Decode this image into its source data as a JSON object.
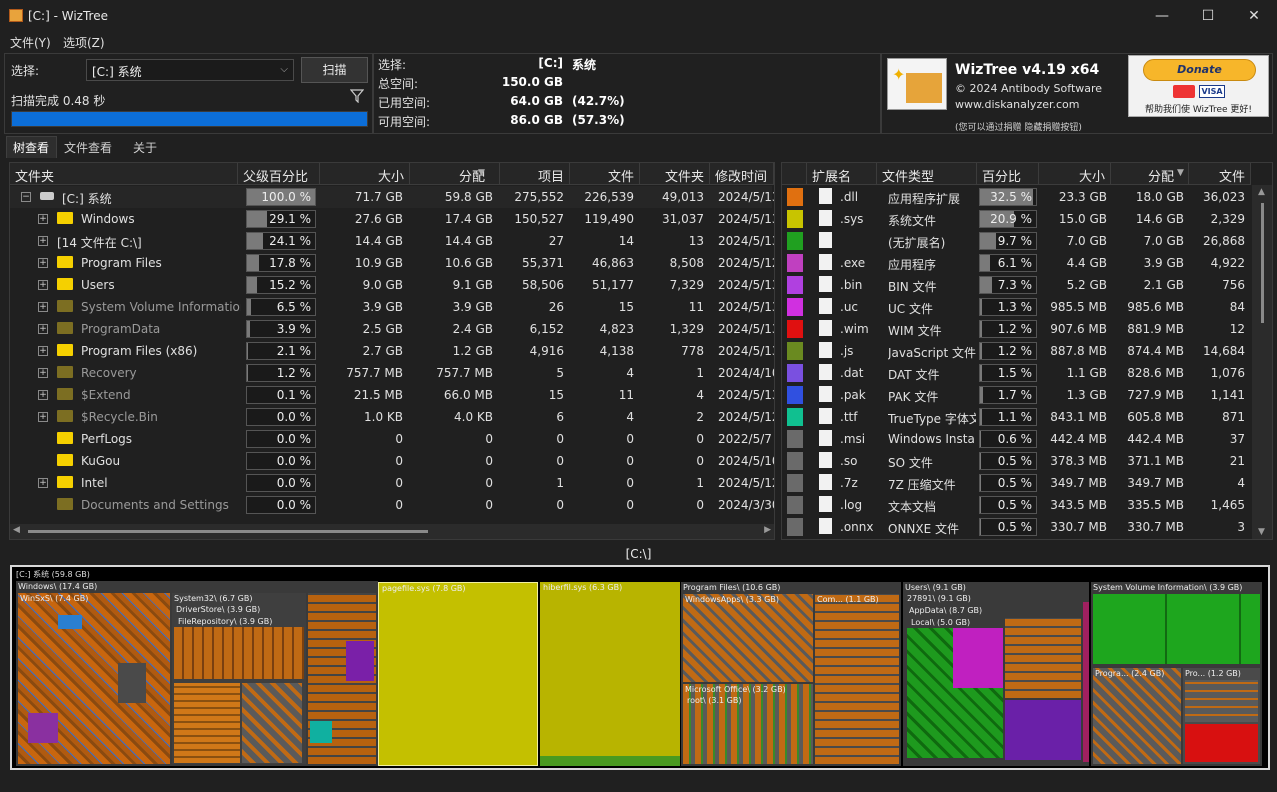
{
  "window": {
    "title": "[C:]  - WizTree",
    "minimize": "—",
    "maximize": "☐",
    "close": "✕"
  },
  "menu": {
    "file": "文件(Y)",
    "options": "选项(Z)"
  },
  "select_panel": {
    "select_label": "选择:",
    "drive_value": "[C:] 系统",
    "scan_button": "扫描",
    "status": "扫描完成 0.48 秒"
  },
  "drive_info": {
    "select_label": "选择:",
    "select_value": "[C:]",
    "select_name": "系统",
    "total_label": "总空间:",
    "total_value": "150.0 GB",
    "used_label": "已用空间:",
    "used_value": "64.0 GB",
    "used_pct": "(42.7%)",
    "free_label": "可用空间:",
    "free_value": "86.0 GB",
    "free_pct": "(57.3%)"
  },
  "about": {
    "app_name": "WizTree v4.19 x64",
    "copyright": "© 2024 Antibody Software",
    "website": "www.diskanalyzer.com",
    "hint": "(您可以通过捐赠 隐藏捐赠按钮)",
    "donate": "Donate",
    "donate_caption": "帮助我们使 WizTree 更好!"
  },
  "tabs": [
    "树查看",
    "文件查看",
    "关于"
  ],
  "tree_headers": [
    "文件夹",
    "父级百分比",
    "大小",
    "分配",
    "项目",
    "文件",
    "文件夹",
    "修改时间"
  ],
  "tree_rows": [
    {
      "name": "[C:] 系统",
      "pct": "100.0 %",
      "pct_value": 1.0,
      "size": "71.7 GB",
      "alloc": "59.8 GB",
      "items": "275,552",
      "files": "226,539",
      "folders": "49,013",
      "modified": "2024/5/13 1",
      "type": "drive"
    },
    {
      "name": "Windows",
      "pct": "29.1 %",
      "pct_value": 0.291,
      "size": "27.6 GB",
      "alloc": "17.4 GB",
      "items": "150,527",
      "files": "119,490",
      "folders": "31,037",
      "modified": "2024/5/13 1",
      "type": "folder"
    },
    {
      "name": "[14 文件在 C:\\]",
      "pct": "24.1 %",
      "pct_value": 0.241,
      "size": "14.4 GB",
      "alloc": "14.4 GB",
      "items": "27",
      "files": "14",
      "folders": "13",
      "modified": "2024/5/13 1",
      "type": "files"
    },
    {
      "name": "Program Files",
      "pct": "17.8 %",
      "pct_value": 0.178,
      "size": "10.9 GB",
      "alloc": "10.6 GB",
      "items": "55,371",
      "files": "46,863",
      "folders": "8,508",
      "modified": "2024/5/12 1",
      "type": "folder"
    },
    {
      "name": "Users",
      "pct": "15.2 %",
      "pct_value": 0.152,
      "size": "9.0 GB",
      "alloc": "9.1 GB",
      "items": "58,506",
      "files": "51,177",
      "folders": "7,329",
      "modified": "2024/5/13 1",
      "type": "folder"
    },
    {
      "name": "System Volume Information",
      "pct": "6.5 %",
      "pct_value": 0.065,
      "size": "3.9 GB",
      "alloc": "3.9 GB",
      "items": "26",
      "files": "15",
      "folders": "11",
      "modified": "2024/5/13 1",
      "type": "sysfolder"
    },
    {
      "name": "ProgramData",
      "pct": "3.9 %",
      "pct_value": 0.039,
      "size": "2.5 GB",
      "alloc": "2.4 GB",
      "items": "6,152",
      "files": "4,823",
      "folders": "1,329",
      "modified": "2024/5/13 1",
      "type": "sysfolder"
    },
    {
      "name": "Program Files (x86)",
      "pct": "2.1 %",
      "pct_value": 0.021,
      "size": "2.7 GB",
      "alloc": "1.2 GB",
      "items": "4,916",
      "files": "4,138",
      "folders": "778",
      "modified": "2024/5/13 1",
      "type": "folder"
    },
    {
      "name": "Recovery",
      "pct": "1.2 %",
      "pct_value": 0.012,
      "size": "757.7 MB",
      "alloc": "757.7 MB",
      "items": "5",
      "files": "4",
      "folders": "1",
      "modified": "2024/4/10 1",
      "type": "sysfolder"
    },
    {
      "name": "$Extend",
      "pct": "0.1 %",
      "pct_value": 0.001,
      "size": "21.5 MB",
      "alloc": "66.0 MB",
      "items": "15",
      "files": "11",
      "folders": "4",
      "modified": "2024/5/13 1",
      "type": "sysfolder"
    },
    {
      "name": "$Recycle.Bin",
      "pct": "0.0 %",
      "pct_value": 0.0,
      "size": "1.0 KB",
      "alloc": "4.0 KB",
      "items": "6",
      "files": "4",
      "folders": "2",
      "modified": "2024/5/12 1",
      "type": "sysfolder"
    },
    {
      "name": "PerfLogs",
      "pct": "0.0 %",
      "pct_value": 0.0,
      "size": "0",
      "alloc": "0",
      "items": "0",
      "files": "0",
      "folders": "0",
      "modified": "2022/5/7 13",
      "type": "folder"
    },
    {
      "name": "KuGou",
      "pct": "0.0 %",
      "pct_value": 0.0,
      "size": "0",
      "alloc": "0",
      "items": "0",
      "files": "0",
      "folders": "0",
      "modified": "2024/5/10 1",
      "type": "folder"
    },
    {
      "name": "Intel",
      "pct": "0.0 %",
      "pct_value": 0.0,
      "size": "0",
      "alloc": "0",
      "items": "1",
      "files": "0",
      "folders": "1",
      "modified": "2024/5/12 2",
      "type": "folder"
    },
    {
      "name": "Documents and Settings",
      "pct": "0.0 %",
      "pct_value": 0.0,
      "size": "0",
      "alloc": "0",
      "items": "0",
      "files": "0",
      "folders": "0",
      "modified": "2024/3/30 1",
      "type": "sysfolder"
    }
  ],
  "ext_headers": [
    "扩展名",
    "文件类型",
    "百分比",
    "大小",
    "分配",
    "文件"
  ],
  "ext_rows": [
    {
      "color": "#e07010",
      "ext": ".dll",
      "type": "应用程序扩展",
      "pct": "32.5 %",
      "pct_value": 0.325,
      "size": "23.3 GB",
      "alloc": "18.0 GB",
      "files": "36,023"
    },
    {
      "color": "#c8c400",
      "ext": ".sys",
      "type": "系统文件",
      "pct": "20.9 %",
      "pct_value": 0.209,
      "size": "15.0 GB",
      "alloc": "14.6 GB",
      "files": "2,329"
    },
    {
      "color": "#20a020",
      "ext": "",
      "type": "(无扩展名)",
      "pct": "9.7 %",
      "pct_value": 0.097,
      "size": "7.0 GB",
      "alloc": "7.0 GB",
      "files": "26,868"
    },
    {
      "color": "#c040c0",
      "ext": ".exe",
      "type": "应用程序",
      "pct": "6.1 %",
      "pct_value": 0.061,
      "size": "4.4 GB",
      "alloc": "3.9 GB",
      "files": "4,922"
    },
    {
      "color": "#b040e0",
      "ext": ".bin",
      "type": "BIN 文件",
      "pct": "7.3 %",
      "pct_value": 0.073,
      "size": "5.2 GB",
      "alloc": "2.1 GB",
      "files": "756"
    },
    {
      "color": "#d030e0",
      "ext": ".uc",
      "type": "UC 文件",
      "pct": "1.3 %",
      "pct_value": 0.013,
      "size": "985.5 MB",
      "alloc": "985.6 MB",
      "files": "84"
    },
    {
      "color": "#e01010",
      "ext": ".wim",
      "type": "WIM 文件",
      "pct": "1.2 %",
      "pct_value": 0.012,
      "size": "907.6 MB",
      "alloc": "881.9 MB",
      "files": "12"
    },
    {
      "color": "#6a8a20",
      "ext": ".js",
      "type": "JavaScript 文件",
      "pct": "1.2 %",
      "pct_value": 0.012,
      "size": "887.8 MB",
      "alloc": "874.4 MB",
      "files": "14,684"
    },
    {
      "color": "#7a50e0",
      "ext": ".dat",
      "type": "DAT 文件",
      "pct": "1.5 %",
      "pct_value": 0.015,
      "size": "1.1 GB",
      "alloc": "828.6 MB",
      "files": "1,076"
    },
    {
      "color": "#3050e0",
      "ext": ".pak",
      "type": "PAK 文件",
      "pct": "1.7 %",
      "pct_value": 0.017,
      "size": "1.3 GB",
      "alloc": "727.9 MB",
      "files": "1,141"
    },
    {
      "color": "#10c090",
      "ext": ".ttf",
      "type": "TrueType 字体文",
      "pct": "1.1 %",
      "pct_value": 0.011,
      "size": "843.1 MB",
      "alloc": "605.8 MB",
      "files": "871"
    },
    {
      "color": "#6a6a6a",
      "ext": ".msi",
      "type": "Windows Installe",
      "pct": "0.6 %",
      "pct_value": 0.006,
      "size": "442.4 MB",
      "alloc": "442.4 MB",
      "files": "37"
    },
    {
      "color": "#6a6a6a",
      "ext": ".so",
      "type": "SO 文件",
      "pct": "0.5 %",
      "pct_value": 0.005,
      "size": "378.3 MB",
      "alloc": "371.1 MB",
      "files": "21"
    },
    {
      "color": "#6a6a6a",
      "ext": ".7z",
      "type": "7Z 压缩文件",
      "pct": "0.5 %",
      "pct_value": 0.005,
      "size": "349.7 MB",
      "alloc": "349.7 MB",
      "files": "4"
    },
    {
      "color": "#6a6a6a",
      "ext": ".log",
      "type": "文本文档",
      "pct": "0.5 %",
      "pct_value": 0.005,
      "size": "343.5 MB",
      "alloc": "335.5 MB",
      "files": "1,465"
    },
    {
      "color": "#6a6a6a",
      "ext": ".onnx",
      "type": "ONNXE 文件",
      "pct": "0.5 %",
      "pct_value": 0.005,
      "size": "330.7 MB",
      "alloc": "330.7 MB",
      "files": "3"
    }
  ],
  "treemap": {
    "path": "[C:\\]",
    "root_label": "[C:] 系统 (59.8 GB)",
    "labels": {
      "windows": "Windows\\ (17.4 GB)",
      "winsxs": "WinSxS\\ (7.4 GB)",
      "system32": "System32\\ (6.7 GB)",
      "driverstore": "DriverStore\\ (3.9 GB)",
      "filerepo": "FileRepository\\ (3.9 GB)",
      "pagefile": "pagefile.sys (7.8 GB)",
      "hiberfil": "hiberfil.sys (6.3 GB)",
      "programfiles": "Program Files\\ (10.6 GB)",
      "windowsapps": "WindowsApps\\ (3.3 GB)",
      "com": "Com... (1.1 GB)",
      "msoffice": "Microsoft Office\\ (3.2 GB)",
      "root": "root\\ (3.1 GB)",
      "users": "Users\\ (9.1 GB)",
      "user": "27891\\ (9.1 GB)",
      "appdata": "AppData\\ (8.7 GB)",
      "local": "Local\\ (5.0 GB)",
      "svi": "System Volume Information\\ (3.9 GB)",
      "programdata": "Progra... (2.4 GB)",
      "pro": "Pro... (1.2 GB)"
    }
  }
}
